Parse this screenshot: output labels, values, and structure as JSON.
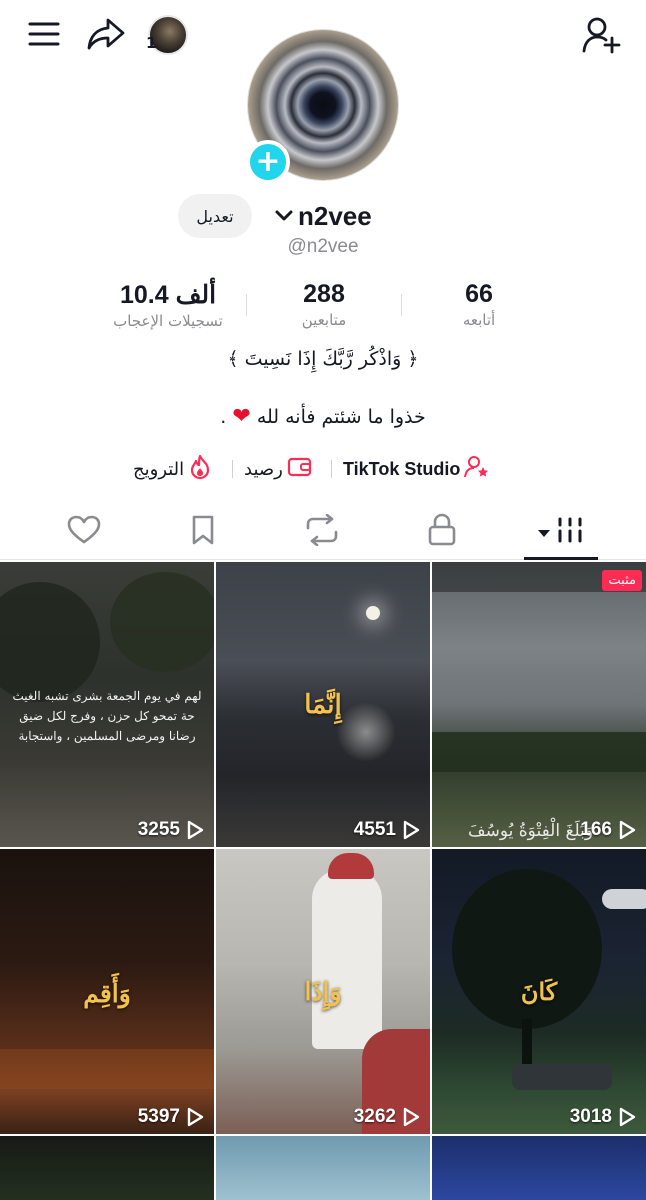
{
  "topbar": {
    "story_count": "1",
    "icons": [
      "menu-icon",
      "share-icon",
      "add-friend-icon"
    ]
  },
  "profile": {
    "edit_label": "تعديل",
    "username": "n2vee",
    "handle": "@n2vee"
  },
  "stats": {
    "likes": {
      "value": "10.4 ألف",
      "label": "تسجيلات الإعجاب"
    },
    "followers": {
      "value": "288",
      "label": "متابعين"
    },
    "following": {
      "value": "66",
      "label": "أتابعه"
    }
  },
  "bio": {
    "line1": "﴿ وَاذْكُر رَّبَّكَ إِذَا نَسِيتَ ﴾",
    "line2": "خذوا ما شئتم فأنه لله",
    "line2_suffix": "."
  },
  "links": {
    "studio": "TikTok Studio",
    "wallet": "رصيد",
    "promote": "الترويج"
  },
  "tabs": [
    "videos-tab",
    "private-tab",
    "reposts-tab",
    "favorites-tab",
    "liked-tab"
  ],
  "grid": {
    "pinned_label": "مثبت",
    "videos": [
      {
        "views": "3255",
        "caption": "",
        "small_caption": [
          "لهم في يوم الجمعة بشرى تشبه الغيث",
          "حة تمحو كل حزن ، وفرج لكل ضيق",
          "رضانا ومرضى المسلمين ، واستجابة"
        ]
      },
      {
        "views": "4551",
        "caption": "إِنَّمَا"
      },
      {
        "views": "166",
        "caption": "",
        "corner_caption": "وَبَلَغَ الْفِتْوَةُ يُوسُفَ",
        "pinned": true
      },
      {
        "views": "5397",
        "caption": "وَأَقِم"
      },
      {
        "views": "3262",
        "caption": "وَإِذَا"
      },
      {
        "views": "3018",
        "caption": "كَانَ"
      }
    ]
  },
  "colors": {
    "accent": "#fe2c55",
    "avatar_add": "#20d5ec",
    "text": "#161823",
    "muted": "#8a8b91"
  }
}
